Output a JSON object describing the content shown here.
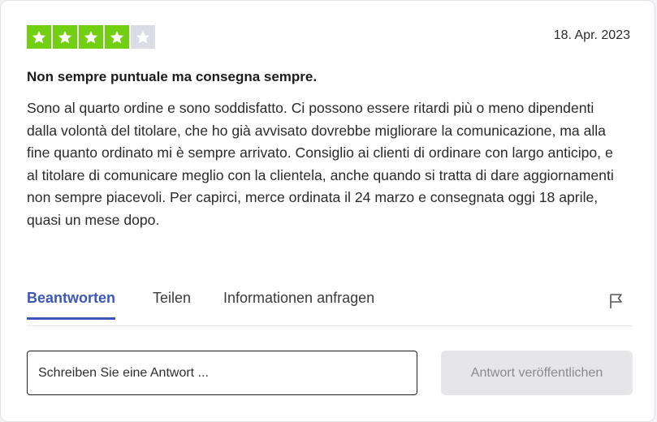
{
  "review": {
    "rating": 4,
    "max_rating": 5,
    "star_color_filled": "#73cf11",
    "star_color_empty": "#dcdce6",
    "date": "18. Apr. 2023",
    "title": "Non sempre puntuale ma consegna sempre.",
    "body": "Sono al quarto ordine e sono soddisfatto. Ci possono essere ritardi più o meno dipendenti dalla volontà del titolare, che ho già avvisato dovrebbe migliorare la comunicazione, ma alla fine quanto ordinato mi è sempre arrivato. Consiglio ai clienti di ordinare con largo anticipo, e al titolare di comunicare meglio con la clientela, anche quando si tratta di dare aggiornamenti non sempre piacevoli. Per capirci, merce ordinata il 24 marzo e consegnata oggi 18 aprile, quasi un mese dopo."
  },
  "tabs": [
    {
      "label": "Beantworten",
      "active": true
    },
    {
      "label": "Teilen",
      "active": false
    },
    {
      "label": "Informationen anfragen",
      "active": false
    }
  ],
  "accent_color": "#3c57b8",
  "flag_icon": "flag-icon",
  "reply": {
    "placeholder": "Schreiben Sie eine Antwort ...",
    "value": "",
    "button_label": "Antwort veröffentlichen"
  }
}
